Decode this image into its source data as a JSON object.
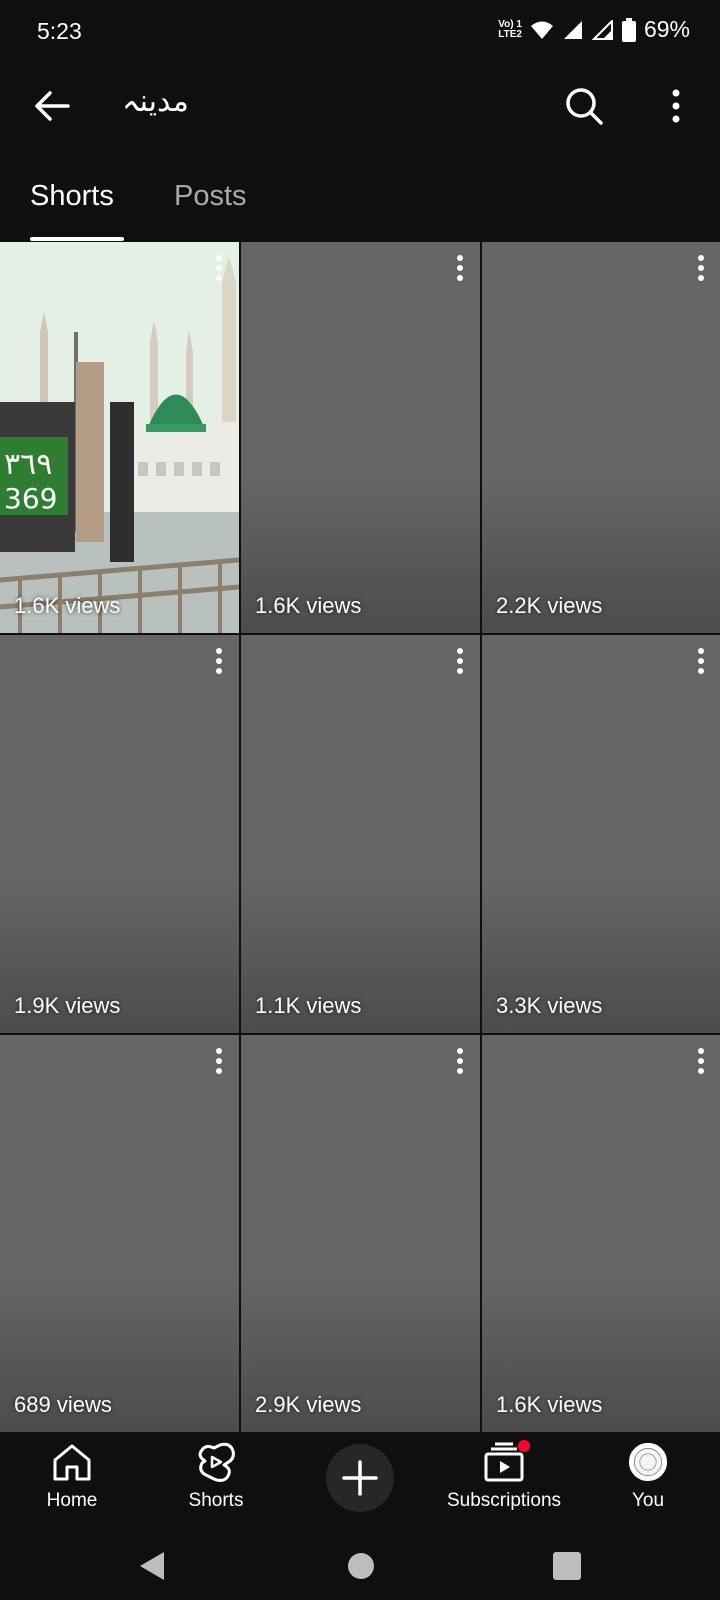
{
  "status_bar": {
    "time": "5:23",
    "lte_top": "Vo) 1",
    "lte_bottom": "LTE2",
    "battery": "69%"
  },
  "header": {
    "title": "مدينہ"
  },
  "tabs": [
    {
      "label": "Shorts"
    },
    {
      "label": "Posts"
    }
  ],
  "grid": {
    "tiles": [
      {
        "views": "1.6K views"
      },
      {
        "views": "1.6K views"
      },
      {
        "views": "2.2K views"
      },
      {
        "views": "1.9K views"
      },
      {
        "views": "1.1K views"
      },
      {
        "views": "3.3K views"
      },
      {
        "views": "689 views"
      },
      {
        "views": "2.9K views"
      },
      {
        "views": "1.6K views"
      }
    ]
  },
  "photo_sign": {
    "line1": "٣٦٩",
    "line2": "369"
  },
  "bottom_nav": {
    "home": "Home",
    "shorts": "Shorts",
    "subscriptions": "Subscriptions",
    "you": "You"
  },
  "colors": {
    "accent_badge": "#ff0033",
    "background": "#0f0f0f",
    "tile": "#666666"
  }
}
